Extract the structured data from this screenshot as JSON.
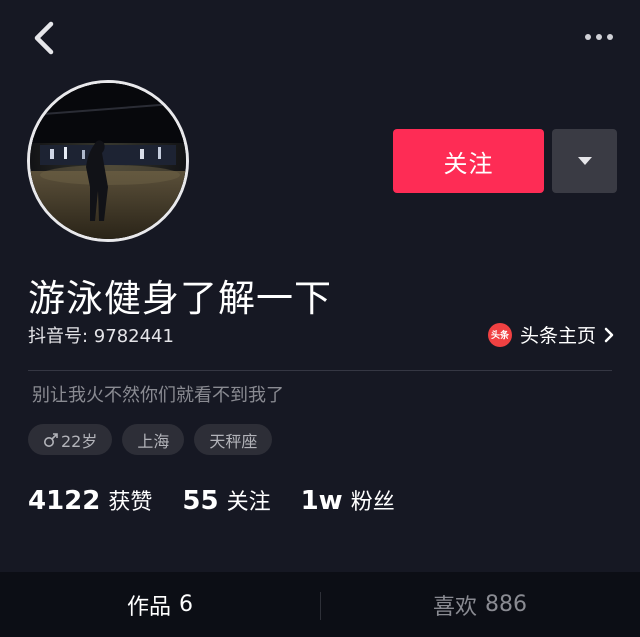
{
  "header": {
    "back_icon": "chevron-left-icon",
    "more_icon": "more-horizontal-icon"
  },
  "profile": {
    "follow_label": "关注",
    "nickname": "游泳健身了解一下",
    "douyin_id": "抖音号: 9782441",
    "toutiao_logo_text": "头条",
    "toutiao_label": "头条主页",
    "signature": "别让我火不然你们就看不到我了",
    "tags": {
      "age": "22岁",
      "city": "上海",
      "zodiac": "天秤座"
    },
    "gender_icon": "male-symbol-icon"
  },
  "stats": {
    "likes_num": "4122",
    "likes_label": "获赞",
    "following_num": "55",
    "following_label": "关注",
    "followers_num": "1w",
    "followers_label": "粉丝"
  },
  "tabs": {
    "works_label": "作品",
    "works_count": "6",
    "likes_label": "喜欢",
    "likes_count": "886"
  },
  "colors": {
    "background": "#161823",
    "accent": "#fe2c55",
    "toutiao_red": "#f04142"
  }
}
